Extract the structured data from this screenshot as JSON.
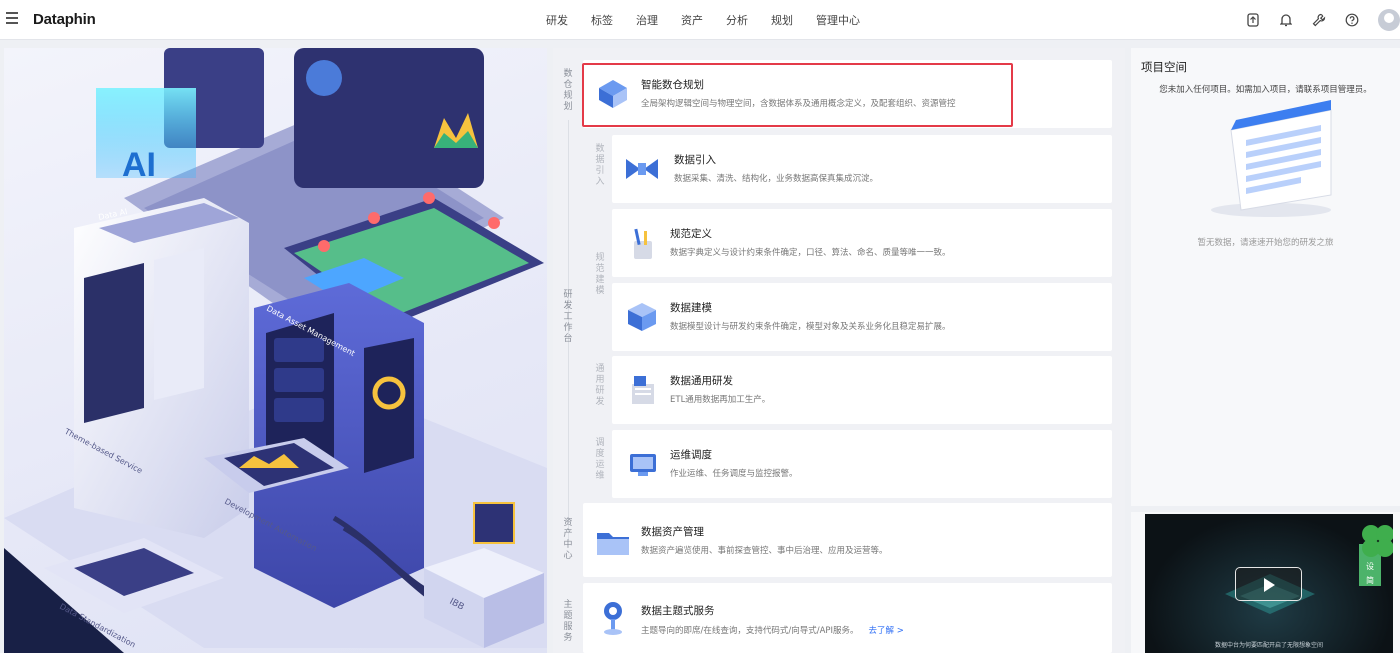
{
  "header": {
    "logo": "Dataphin",
    "nav": [
      "研发",
      "标签",
      "治理",
      "资产",
      "分析",
      "规划",
      "管理中心"
    ],
    "tools": [
      "upload-icon",
      "bell-icon",
      "wrench-icon",
      "help-icon",
      "avatar"
    ]
  },
  "illustration": {
    "labels": {
      "ai": "AI",
      "data_ai": "Data AI",
      "asset_mgmt": "Data Asset Management",
      "theme_service": "Theme-based Service",
      "dev_automation": "Development Automation",
      "standardization": "Data Standardization",
      "ibb": "IBB"
    }
  },
  "middle": {
    "sections": {
      "plan": "数仓规划",
      "ingest": "数据引入",
      "spec": "规范建模",
      "dev": "研发工作台",
      "general": "通用研发",
      "ops": "调度运维",
      "asset": "资产中心",
      "service": "主题服务"
    },
    "cards": [
      {
        "title": "智能数仓规划",
        "desc": "全局架构逻辑空间与物理空间，含数据体系及通用概念定义，及配套组织、资源管控"
      },
      {
        "title": "数据引入",
        "desc": "数据采集、清洗、结构化，业务数据高保真集成沉淀。"
      },
      {
        "title": "规范定义",
        "desc": "数据字典定义与设计约束条件确定，口径、算法、命名、质量等唯一一致。"
      },
      {
        "title": "数据建模",
        "desc": "数据模型设计与研发约束条件确定，模型对象及关系业务化且稳定易扩展。"
      },
      {
        "title": "数据通用研发",
        "desc": "ETL通用数据再加工生产。"
      },
      {
        "title": "运维调度",
        "desc": "作业运维、任务调度与监控报警。"
      },
      {
        "title": "数据资产管理",
        "desc": "数据资产遍览使用、事前探查管控、事中后治理、应用及运营等。"
      },
      {
        "title": "数据主题式服务",
        "desc": "主题导向的即席/在线查询，支持代码式/向导式/API服务。",
        "more": "去了解 >"
      }
    ]
  },
  "right": {
    "title": "项目空间",
    "subtitle": "您未加入任何项目。如需加入项目，请联系项目管理员。",
    "empty": "暂无数据，请速速开始您的研发之旅",
    "video_caption": "数据中台为何要匹配开启了无限想象空间",
    "tag": [
      "中",
      "设",
      "简"
    ]
  }
}
